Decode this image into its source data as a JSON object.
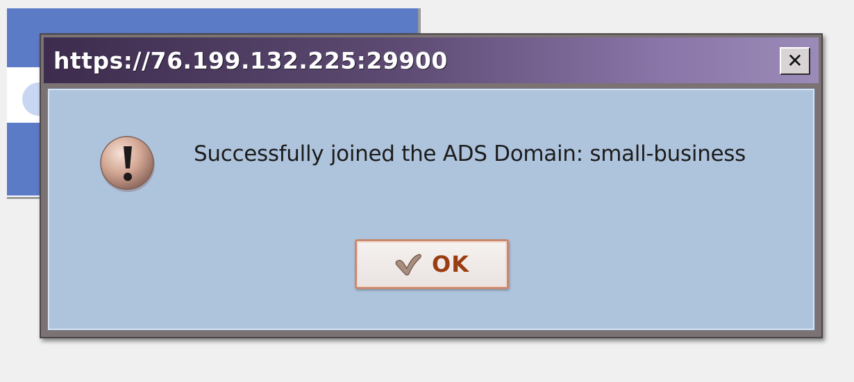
{
  "dialog": {
    "title": "https://76.199.132.225:29900",
    "close_icon": "close-icon",
    "message_icon": "exclamation-icon",
    "message": "Successfully joined the ADS Domain: small-business",
    "ok_icon": "checkmark-icon",
    "ok_label": "OK"
  },
  "colors": {
    "titlebar_start": "#3d2c4d",
    "titlebar_end": "#9b8bb8",
    "body_background": "#aec3dc",
    "ok_label": "#9a3d12",
    "background_window_accent": "#5c7bc7"
  }
}
